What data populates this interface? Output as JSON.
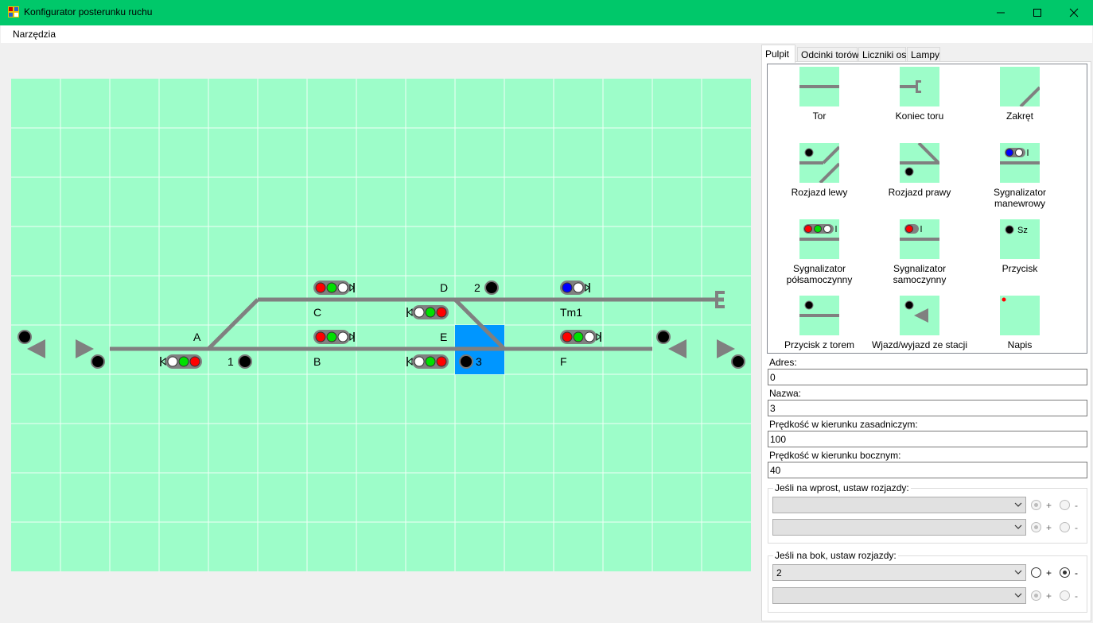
{
  "window": {
    "title": "Konfigurator posterunku ruchu",
    "minimize_icon": "minimize-icon",
    "maximize_icon": "maximize-icon",
    "close_icon": "close-icon"
  },
  "menu": {
    "tools": "Narzędzia"
  },
  "layout_labels": {
    "A": "A",
    "B": "B",
    "C": "C",
    "D": "D",
    "E": "E",
    "F": "F",
    "n1": "1",
    "n2": "2",
    "n3": "3",
    "tm1": "Tm1"
  },
  "colors": {
    "titlebar": "#00c86a",
    "grid_bg": "#9dfdc9",
    "track": "#808080",
    "selection": "#0096ff",
    "lamp_red": "#ff0000",
    "lamp_green": "#00e000",
    "lamp_blue": "#0000ff",
    "lamp_white": "#ffffff"
  },
  "tabs": [
    {
      "label": "Pulpit",
      "active": true
    },
    {
      "label": "Odcinki torów",
      "active": false
    },
    {
      "label": "Liczniki osi",
      "active": false
    },
    {
      "label": "Lampy",
      "active": false
    }
  ],
  "palette": [
    {
      "label": "Tor",
      "icon": "track-icon"
    },
    {
      "label": "Koniec toru",
      "icon": "track-end-icon"
    },
    {
      "label": "Zakręt",
      "icon": "curve-icon"
    },
    {
      "label": "Rozjazd lewy",
      "icon": "switch-left-icon"
    },
    {
      "label": "Rozjazd prawy",
      "icon": "switch-right-icon"
    },
    {
      "label": "Sygnalizator manewrowy",
      "icon": "shunting-signal-icon"
    },
    {
      "label": "Sygnalizator półsamoczynny",
      "icon": "semi-auto-signal-icon"
    },
    {
      "label": "Sygnalizator samoczynny",
      "icon": "auto-signal-icon"
    },
    {
      "label": "Przycisk",
      "icon": "button-icon",
      "text": "Sz"
    },
    {
      "label": "Przycisk z torem",
      "icon": "button-track-icon"
    },
    {
      "label": "Wjazd/wyjazd ze stacji",
      "icon": "station-entry-icon"
    },
    {
      "label": "Napis",
      "icon": "label-icon"
    }
  ],
  "form": {
    "address_label": "Adres:",
    "address_value": "0",
    "name_label": "Nazwa:",
    "name_value": "3",
    "speed_main_label": "Prędkość w kierunku zasadniczym:",
    "speed_main_value": "100",
    "speed_side_label": "Prędkość w kierunku bocznym:",
    "speed_side_value": "40",
    "straight_group": {
      "legend": "Jeśli na wprost, ustaw rozjazdy:",
      "rows": [
        {
          "value": "",
          "plus": "+",
          "minus": "-",
          "selected": "plus",
          "enabled": false
        },
        {
          "value": "",
          "plus": "+",
          "minus": "-",
          "selected": "plus",
          "enabled": false
        }
      ]
    },
    "side_group": {
      "legend": "Jeśli na bok, ustaw rozjazdy:",
      "rows": [
        {
          "value": "2",
          "plus": "+",
          "minus": "-",
          "selected": "minus",
          "enabled": true
        },
        {
          "value": "",
          "plus": "+",
          "minus": "-",
          "selected": "plus",
          "enabled": false
        }
      ]
    }
  }
}
